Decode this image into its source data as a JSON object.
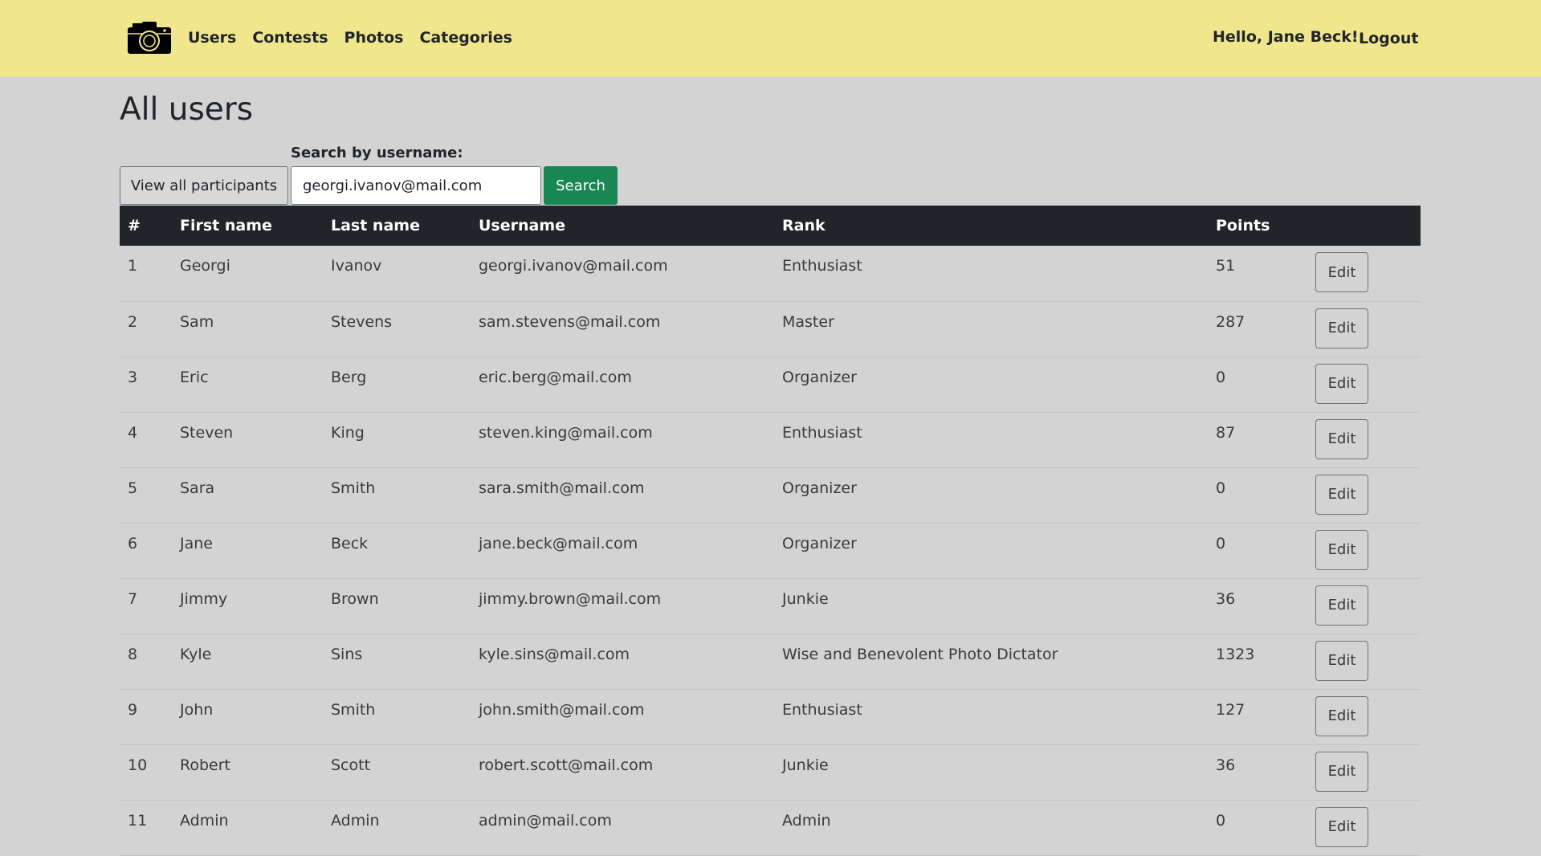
{
  "navbar": {
    "links": [
      "Users",
      "Contests",
      "Photos",
      "Categories"
    ],
    "greeting": "Hello, Jane Beck!",
    "logout_label": "Logout"
  },
  "page": {
    "title": "All users"
  },
  "search": {
    "label": "Search by username:",
    "value": "georgi.ivanov@mail.com",
    "button_label": "Search",
    "view_all_label": "View all participants"
  },
  "table": {
    "columns": [
      "#",
      "First name",
      "Last name",
      "Username",
      "Rank",
      "Points"
    ],
    "edit_label": "Edit",
    "rows": [
      {
        "num": "1",
        "first": "Georgi",
        "last": "Ivanov",
        "username": "georgi.ivanov@mail.com",
        "rank": "Enthusiast",
        "points": "51"
      },
      {
        "num": "2",
        "first": "Sam",
        "last": "Stevens",
        "username": "sam.stevens@mail.com",
        "rank": "Master",
        "points": "287"
      },
      {
        "num": "3",
        "first": "Eric",
        "last": "Berg",
        "username": "eric.berg@mail.com",
        "rank": "Organizer",
        "points": "0"
      },
      {
        "num": "4",
        "first": "Steven",
        "last": "King",
        "username": "steven.king@mail.com",
        "rank": "Enthusiast",
        "points": "87"
      },
      {
        "num": "5",
        "first": "Sara",
        "last": "Smith",
        "username": "sara.smith@mail.com",
        "rank": "Organizer",
        "points": "0"
      },
      {
        "num": "6",
        "first": "Jane",
        "last": "Beck",
        "username": "jane.beck@mail.com",
        "rank": "Organizer",
        "points": "0"
      },
      {
        "num": "7",
        "first": "Jimmy",
        "last": "Brown",
        "username": "jimmy.brown@mail.com",
        "rank": "Junkie",
        "points": "36"
      },
      {
        "num": "8",
        "first": "Kyle",
        "last": "Sins",
        "username": "kyle.sins@mail.com",
        "rank": "Wise and Benevolent Photo Dictator",
        "points": "1323"
      },
      {
        "num": "9",
        "first": "John",
        "last": "Smith",
        "username": "john.smith@mail.com",
        "rank": "Enthusiast",
        "points": "127"
      },
      {
        "num": "10",
        "first": "Robert",
        "last": "Scott",
        "username": "robert.scott@mail.com",
        "rank": "Junkie",
        "points": "36"
      },
      {
        "num": "11",
        "first": "Admin",
        "last": "Admin",
        "username": "admin@mail.com",
        "rank": "Admin",
        "points": "0"
      }
    ]
  },
  "colors": {
    "navbar_bg": "#f0e68c",
    "page_bg": "#d3d3d3",
    "table_header_bg": "#212529",
    "search_button_bg": "#198754"
  },
  "icons": {
    "logo": "camera-icon"
  }
}
